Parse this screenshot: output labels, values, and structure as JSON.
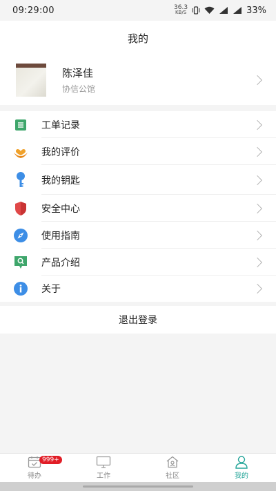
{
  "status_bar": {
    "time": "09:29:00",
    "net_speed": "36.3",
    "net_unit": "KB/S",
    "battery": "33%"
  },
  "header": {
    "title": "我的"
  },
  "profile": {
    "name": "陈泽佳",
    "org": "协信公馆"
  },
  "menu": [
    {
      "label": "工单记录",
      "icon": "document-icon",
      "color": "#3ea66b"
    },
    {
      "label": "我的评价",
      "icon": "heart-hands-icon",
      "color": "#f0a12a"
    },
    {
      "label": "我的钥匙",
      "icon": "key-icon",
      "color": "#3d8ee6"
    },
    {
      "label": "安全中心",
      "icon": "shield-icon",
      "color": "#e04848"
    },
    {
      "label": "使用指南",
      "icon": "compass-icon",
      "color": "#3d8ee6"
    },
    {
      "label": "产品介绍",
      "icon": "chat-search-icon",
      "color": "#3ea66b"
    },
    {
      "label": "关于",
      "icon": "info-icon",
      "color": "#3d8ee6"
    }
  ],
  "logout": {
    "label": "退出登录"
  },
  "tabbar": {
    "tabs": [
      {
        "label": "待办",
        "icon": "calendar-check-icon"
      },
      {
        "label": "工作",
        "icon": "monitor-icon"
      },
      {
        "label": "社区",
        "icon": "home-icon"
      },
      {
        "label": "我的",
        "icon": "user-icon"
      }
    ],
    "badge": "999+",
    "active_color": "#26a69a"
  }
}
